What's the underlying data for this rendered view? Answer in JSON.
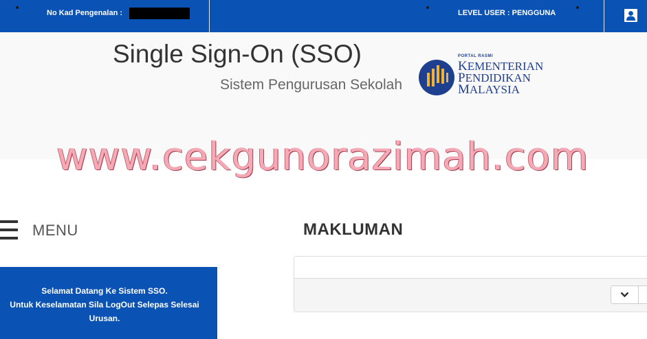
{
  "topbar": {
    "id_label": "No Kad Pengenalan :",
    "level_label": "LEVEL USER : PENGGUNA",
    "user_icon": "user-icon",
    "bg_color": "#0a52b3"
  },
  "header": {
    "title": "Single Sign-On (SSO)",
    "subtitle": "Sistem Pengurusan Sekolah",
    "logo": {
      "small_text": "PORTAL RASMI",
      "line1": "KEMENTERIAN",
      "line2": "PENDIDIKAN",
      "line3": "MALAYSIA"
    }
  },
  "watermark": "www.cekgunorazimah.com",
  "menu": {
    "label": "MENU",
    "icon": "hamburger-icon"
  },
  "welcome": {
    "line1": "Selamat Datang Ke Sistem SSO.",
    "line2": "Untuk Keselamatan Sila LogOut Selepas Selesai",
    "line3": "Urusan."
  },
  "makluman": {
    "title": "MAKLUMAN",
    "collapse_icon": "chevron-down-icon"
  }
}
